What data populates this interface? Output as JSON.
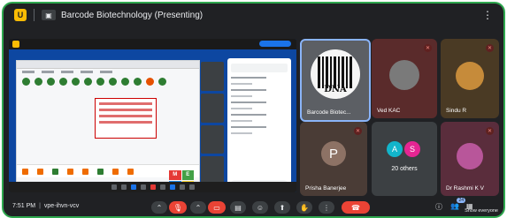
{
  "meeting": {
    "title": "Barcode Biotechnology (Presenting)",
    "time": "7:51 PM",
    "separator": "|",
    "code": "vpe-ihvn-vcv"
  },
  "participants": [
    {
      "name": "Barcode Biotec...",
      "logo_text": "DNA"
    },
    {
      "name": "Ved KAC"
    },
    {
      "name": "Sindu R"
    },
    {
      "name": "Prisha Banerjee",
      "initial": "P"
    },
    {
      "name": "20 others",
      "initials": [
        "A",
        "S"
      ]
    },
    {
      "name": "Dr Rashmi K V"
    }
  ],
  "controls": {
    "raise_count": "24",
    "show_all_label": "Show everyone"
  },
  "colors": {
    "accent": "#8ab4f8",
    "end_call": "#ea4335",
    "frame_border": "#2fa84f",
    "muted": "#f28b82"
  }
}
